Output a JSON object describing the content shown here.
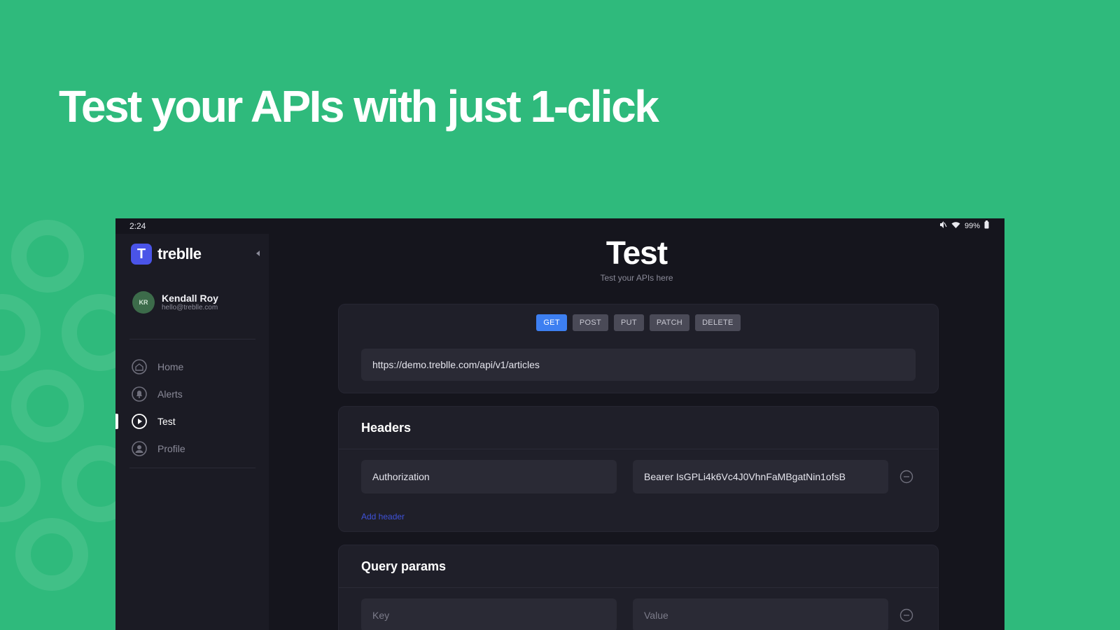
{
  "headline": "Test your APIs with just 1-click",
  "statusbar": {
    "time": "2:24",
    "battery": "99%"
  },
  "sidebar": {
    "brand": "treblle",
    "brand_logo_letter": "T",
    "user": {
      "initials": "KR",
      "name": "Kendall Roy",
      "email": "hello@treblle.com"
    },
    "nav": [
      {
        "label": "Home",
        "icon": "home-icon"
      },
      {
        "label": "Alerts",
        "icon": "alerts-icon"
      },
      {
        "label": "Test",
        "icon": "play-icon",
        "active": true
      },
      {
        "label": "Profile",
        "icon": "profile-icon"
      }
    ]
  },
  "main": {
    "title": "Test",
    "subtitle": "Test your APIs here",
    "methods": [
      "GET",
      "POST",
      "PUT",
      "PATCH",
      "DELETE"
    ],
    "selected_method": "GET",
    "url": "https://demo.treblle.com/api/v1/articles",
    "headers": {
      "title": "Headers",
      "key": "Authorization",
      "value": "Bearer IsGPLi4k6Vc4J0VhnFaMBgatNin1ofsB",
      "add_label": "Add header"
    },
    "query_params": {
      "title": "Query params",
      "key_placeholder": "Key",
      "value_placeholder": "Value"
    }
  },
  "colors": {
    "background": "#2fba7c",
    "accent": "#3d7ff1",
    "brand": "#4a54e8"
  }
}
